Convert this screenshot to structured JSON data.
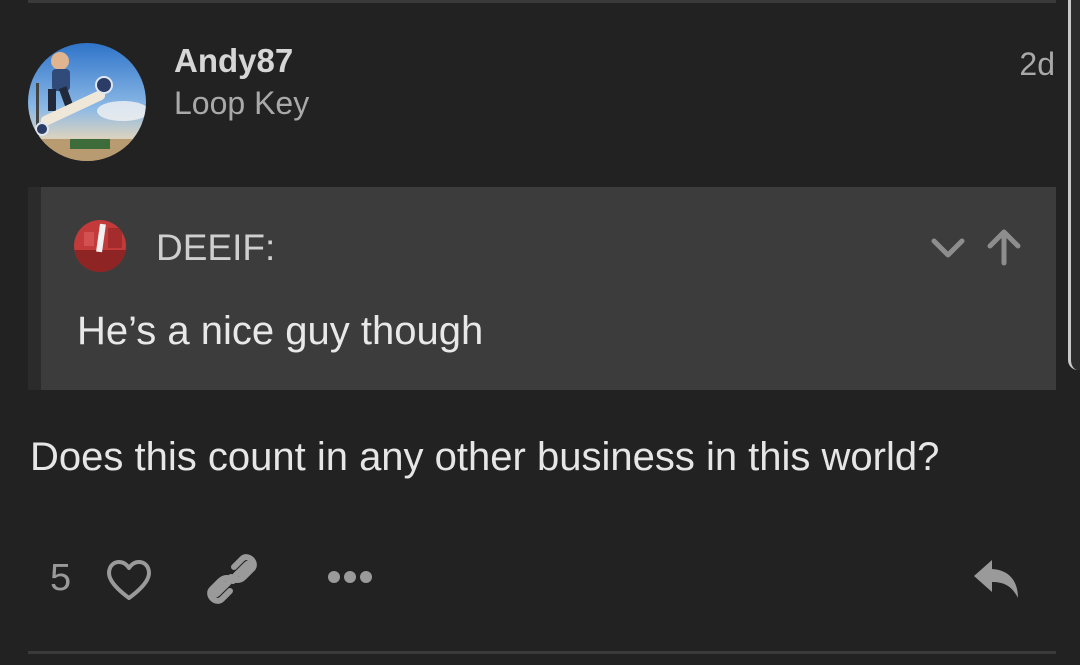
{
  "post": {
    "author": "Andy87",
    "author_title": "Loop Key",
    "time_ago": "2d",
    "avatar_icon": "skateboarder-photo-avatar",
    "body": "Does this count in any other business in this world?"
  },
  "quote": {
    "author": "DEEIF:",
    "avatar_icon": "red-photo-avatar",
    "text": "He’s a nice guy though",
    "controls": [
      "chevron-down-icon",
      "arrow-up-icon"
    ]
  },
  "actions": {
    "like_count": "5",
    "icons": [
      "heart-icon",
      "link-icon",
      "more-icon",
      "reply-icon"
    ]
  },
  "colors": {
    "background": "#222222",
    "quote_background": "#3c3c3c",
    "text_primary": "#e6e6e6",
    "text_muted": "#a9a9a9",
    "icon": "#9a9a9a"
  }
}
